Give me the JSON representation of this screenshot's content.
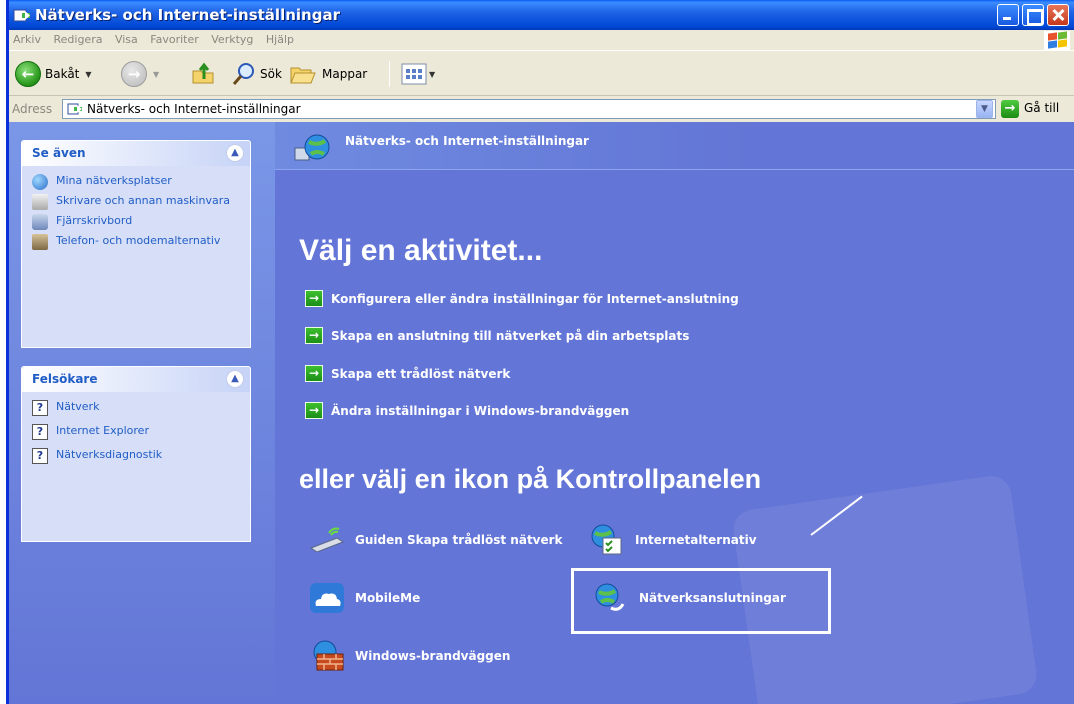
{
  "window": {
    "title": "Nätverks- och Internet-inställningar",
    "controls": {
      "minimize": "min",
      "maximize": "max",
      "close": "close"
    }
  },
  "menu": [
    "Arkiv",
    "Redigera",
    "Visa",
    "Favoriter",
    "Verktyg",
    "Hjälp"
  ],
  "toolbar": {
    "back_label": "Bakåt",
    "search_label": "Sök",
    "folders_label": "Mappar"
  },
  "address": {
    "label": "Adress",
    "value": "Nätverks- och Internet-inställningar",
    "go_label": "Gå till"
  },
  "sidebar": {
    "see_also": {
      "title": "Se även",
      "items": [
        {
          "label": "Mina nätverksplatser",
          "icon": "network-places-icon"
        },
        {
          "label": "Skrivare och annan maskinvara",
          "icon": "printer-icon"
        },
        {
          "label": "Fjärrskrivbord",
          "icon": "remote-desktop-icon"
        },
        {
          "label": "Telefon- och modemalternativ",
          "icon": "phone-icon"
        }
      ]
    },
    "troubleshooters": {
      "title": "Felsökare",
      "items": [
        {
          "label": "Nätverk",
          "icon": "help-icon"
        },
        {
          "label": "Internet Explorer",
          "icon": "help-icon"
        },
        {
          "label": "Nätverksdiagnostik",
          "icon": "help-icon"
        }
      ]
    }
  },
  "main": {
    "header": "Nätverks- och Internet-inställningar",
    "pick_task": "Välj en aktivitet...",
    "tasks": [
      "Konfigurera eller ändra inställningar för Internet-anslutning",
      "Skapa en anslutning till nätverket på din arbetsplats",
      "Skapa ett trådlöst nätverk",
      "Ändra inställningar i Windows-brandväggen"
    ],
    "pick_icon": "eller välj en ikon på Kontrollpanelen",
    "icons": [
      {
        "label": "Guiden Skapa trådlöst nätverk",
        "icon": "wireless-wizard-icon"
      },
      {
        "label": "Internetalternativ",
        "icon": "internet-options-icon"
      },
      {
        "label": "MobileMe",
        "icon": "mobileme-cloud-icon"
      },
      {
        "label": "Nätverksanslutningar",
        "icon": "network-connections-icon"
      },
      {
        "label": "Windows-brandväggen",
        "icon": "firewall-icon"
      }
    ]
  },
  "colors": {
    "window_blue": "#6375d6",
    "title_blue": "#0a5ff2",
    "link_blue": "#215dc6",
    "task_arrow": "#1c8f17"
  }
}
